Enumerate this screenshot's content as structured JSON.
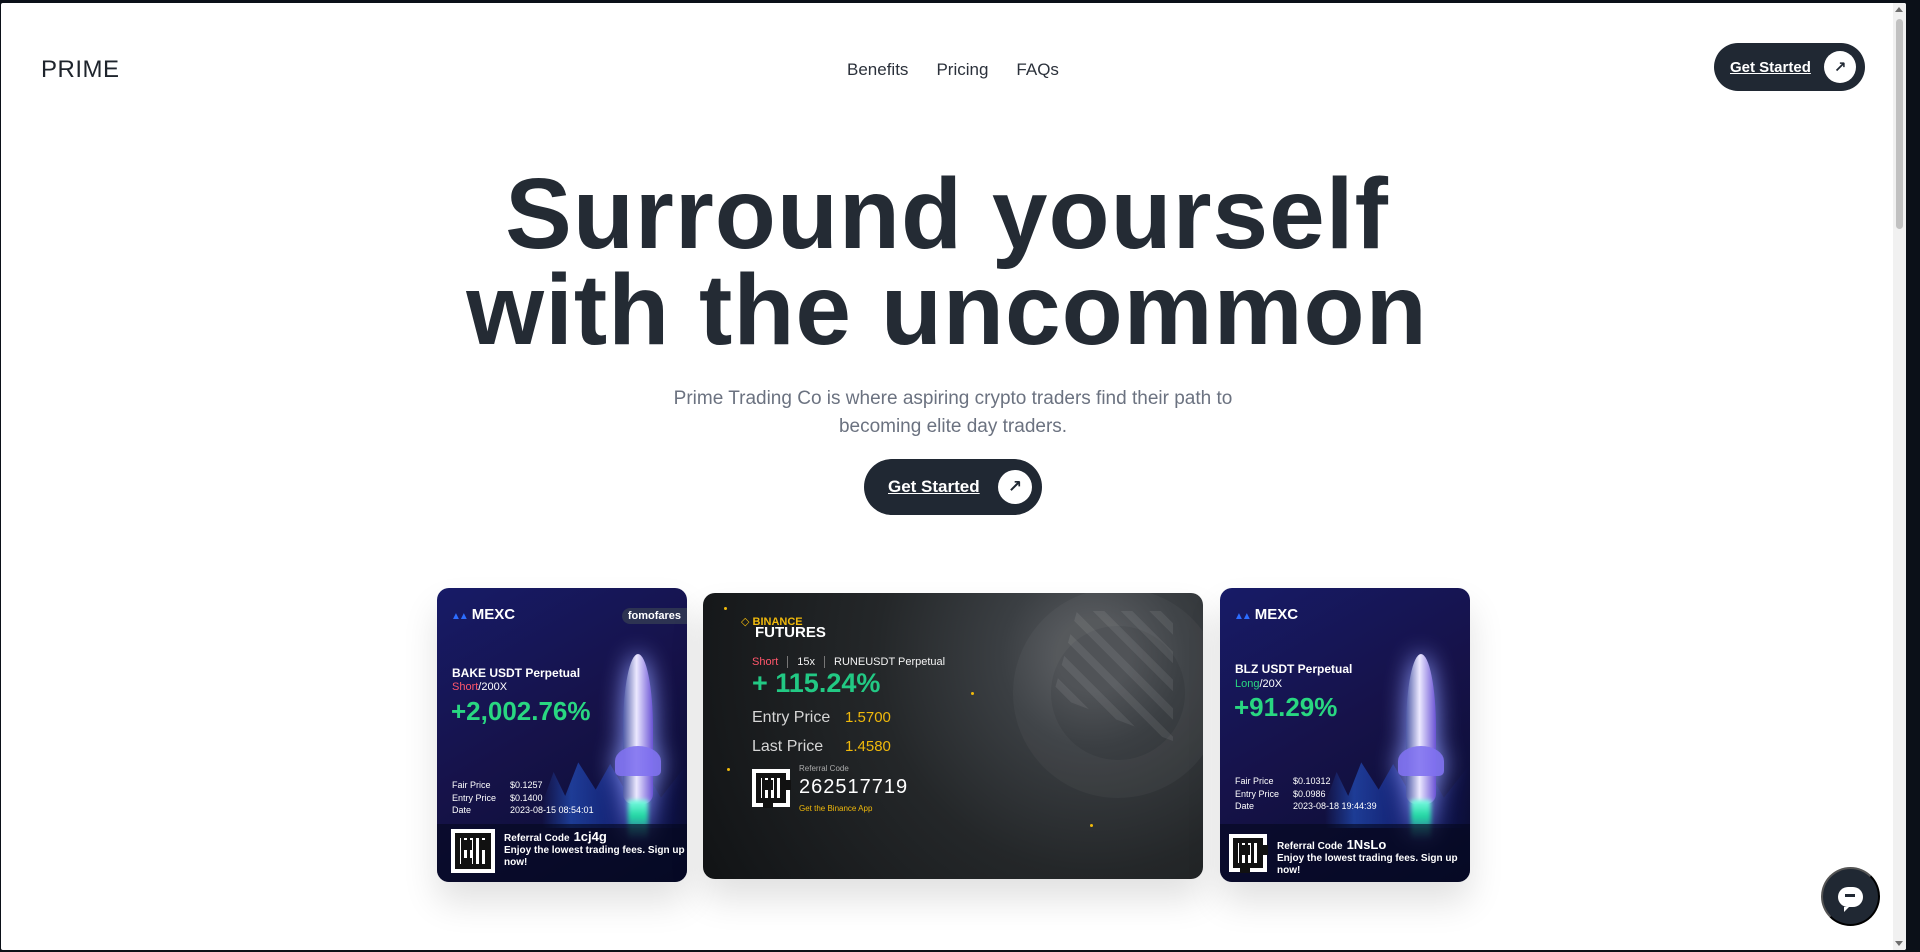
{
  "brand": {
    "logo": "PRIME"
  },
  "nav": {
    "items": [
      "Benefits",
      "Pricing",
      "FAQs"
    ]
  },
  "header": {
    "cta": "Get Started"
  },
  "hero": {
    "title_line_1": "Surround yourself",
    "title_line_2": "with the uncommon",
    "subtitle": "Prime Trading Co is where aspiring crypto traders find their path to becoming elite day traders.",
    "cta": "Get Started"
  },
  "cards": {
    "mexc_left": {
      "exchange": "MEXC",
      "user": "fomofares",
      "pair": "BAKE USDT Perpetual",
      "direction": "Short",
      "leverage": "/200X",
      "gain": "+2,002.76%",
      "fair_price_label": "Fair Price",
      "fair_price": "$0.1257",
      "entry_price_label": "Entry Price",
      "entry_price": "$0.1400",
      "date_label": "Date",
      "date": "2023-08-15 08:54:01",
      "referral_label": "Referral Code",
      "referral_code": "1cj4g",
      "referral_text": "Enjoy the lowest trading fees. Sign up now!"
    },
    "binance": {
      "brand": "BINANCE",
      "product": "FUTURES",
      "side": "Short",
      "leverage": "15x",
      "pair": "RUNEUSDT Perpetual",
      "gain": "+ 115.24%",
      "entry_label": "Entry Price",
      "entry_price": "1.5700",
      "last_label": "Last Price",
      "last_price": "1.4580",
      "referral_label": "Referral Code",
      "referral_code": "262517719",
      "app_text": "Get the Binance App"
    },
    "mexc_right": {
      "exchange": "MEXC",
      "pair": "BLZ USDT Perpetual",
      "direction": "Long",
      "leverage": "/20X",
      "gain": "+91.29%",
      "fair_price_label": "Fair Price",
      "fair_price": "$0.10312",
      "entry_price_label": "Entry Price",
      "entry_price": "$0.0986",
      "date_label": "Date",
      "date": "2023-08-18 19:44:39",
      "referral_label": "Referral Code",
      "referral_code": "1NsLo",
      "referral_text": "Enjoy the lowest trading fees. Sign up now!"
    }
  },
  "icons": {
    "arrow": "arrow-up-right-icon",
    "chat": "chat-bubble-icon"
  },
  "colors": {
    "dark": "#202833",
    "green": "#29d781",
    "red": "#ff566b",
    "gold": "#f0b90b"
  }
}
